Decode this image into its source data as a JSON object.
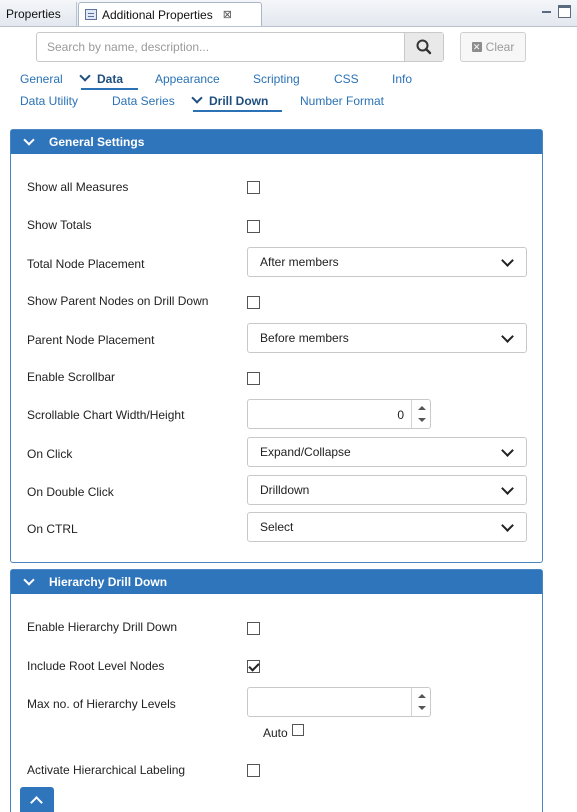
{
  "view_tabs": [
    {
      "label": "Properties"
    },
    {
      "label": "Additional Properties",
      "close": "⊠"
    }
  ],
  "search": {
    "placeholder": "Search by name, description...",
    "clear_label": "Clear"
  },
  "tabs_row1": [
    {
      "label": "General"
    },
    {
      "label": "Data",
      "active": true
    },
    {
      "label": "Appearance"
    },
    {
      "label": "Scripting"
    },
    {
      "label": "CSS"
    },
    {
      "label": "Info"
    }
  ],
  "tabs_row2": [
    {
      "label": "Data Utility"
    },
    {
      "label": "Data Series"
    },
    {
      "label": "Drill Down",
      "active": true
    },
    {
      "label": "Number Format"
    }
  ],
  "general_settings": {
    "title": "General Settings",
    "show_all_measures": {
      "label": "Show all Measures",
      "checked": false
    },
    "show_totals": {
      "label": "Show Totals",
      "checked": false
    },
    "total_node_placement": {
      "label": "Total Node Placement",
      "value": "After members"
    },
    "show_parent_nodes": {
      "label": "Show Parent Nodes on Drill Down",
      "checked": false
    },
    "parent_node_placement": {
      "label": "Parent Node Placement",
      "value": "Before members"
    },
    "enable_scrollbar": {
      "label": "Enable Scrollbar",
      "checked": false
    },
    "scrollable_size": {
      "label": "Scrollable Chart Width/Height",
      "value": "0"
    },
    "on_click": {
      "label": "On Click",
      "value": "Expand/Collapse"
    },
    "on_double_click": {
      "label": "On Double Click",
      "value": "Drilldown"
    },
    "on_ctrl": {
      "label": "On CTRL",
      "value": "Select"
    }
  },
  "hierarchy_drill_down": {
    "title": "Hierarchy Drill Down",
    "enable": {
      "label": "Enable Hierarchy Drill Down",
      "checked": false
    },
    "include_root": {
      "label": "Include Root Level Nodes",
      "checked": true
    },
    "max_levels": {
      "label": "Max no. of Hierarchy Levels",
      "value": "",
      "auto_label": "Auto",
      "auto_checked": false
    },
    "hierarchical_labeling": {
      "label": "Activate Hierarchical Labeling",
      "checked": false
    }
  },
  "colors": {
    "accent": "#2f75bb",
    "link": "#2a72b5"
  }
}
